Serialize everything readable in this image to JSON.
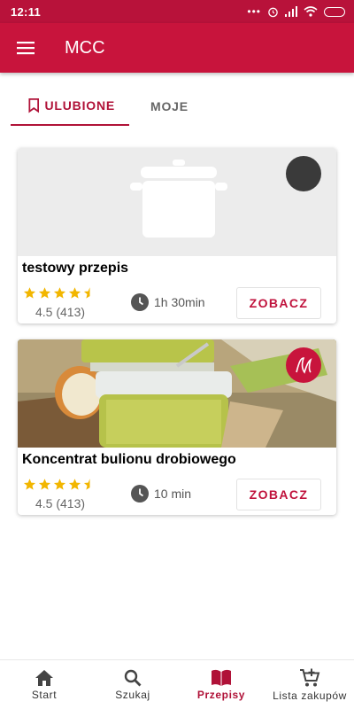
{
  "status_bar": {
    "time": "12:11"
  },
  "app_bar": {
    "title": "MCC"
  },
  "tabs": [
    {
      "label": "ULUBIONE",
      "active": true
    },
    {
      "label": "MOJE",
      "active": false
    }
  ],
  "recipes": [
    {
      "title": "testowy przepis",
      "rating": "4.5 (413)",
      "stars": 4.5,
      "time": "1h 30min",
      "button": "ZOBACZ",
      "image": "pot-icon-placeholder"
    },
    {
      "title": "Koncentrat bulionu drobiowego",
      "rating": "4.5 (413)",
      "stars": 4.5,
      "time": "10 min",
      "button": "ZOBACZ",
      "image": "jar-photo"
    }
  ],
  "bottom_nav": [
    {
      "label": "Start",
      "icon": "home-icon",
      "active": false
    },
    {
      "label": "Szukaj",
      "icon": "search-icon",
      "active": false
    },
    {
      "label": "Przepisy",
      "icon": "book-icon",
      "active": true
    },
    {
      "label": "Lista zakupów",
      "icon": "cart-icon",
      "active": false
    }
  ],
  "colors": {
    "primary": "#c8143c",
    "star": "#f2b600"
  }
}
